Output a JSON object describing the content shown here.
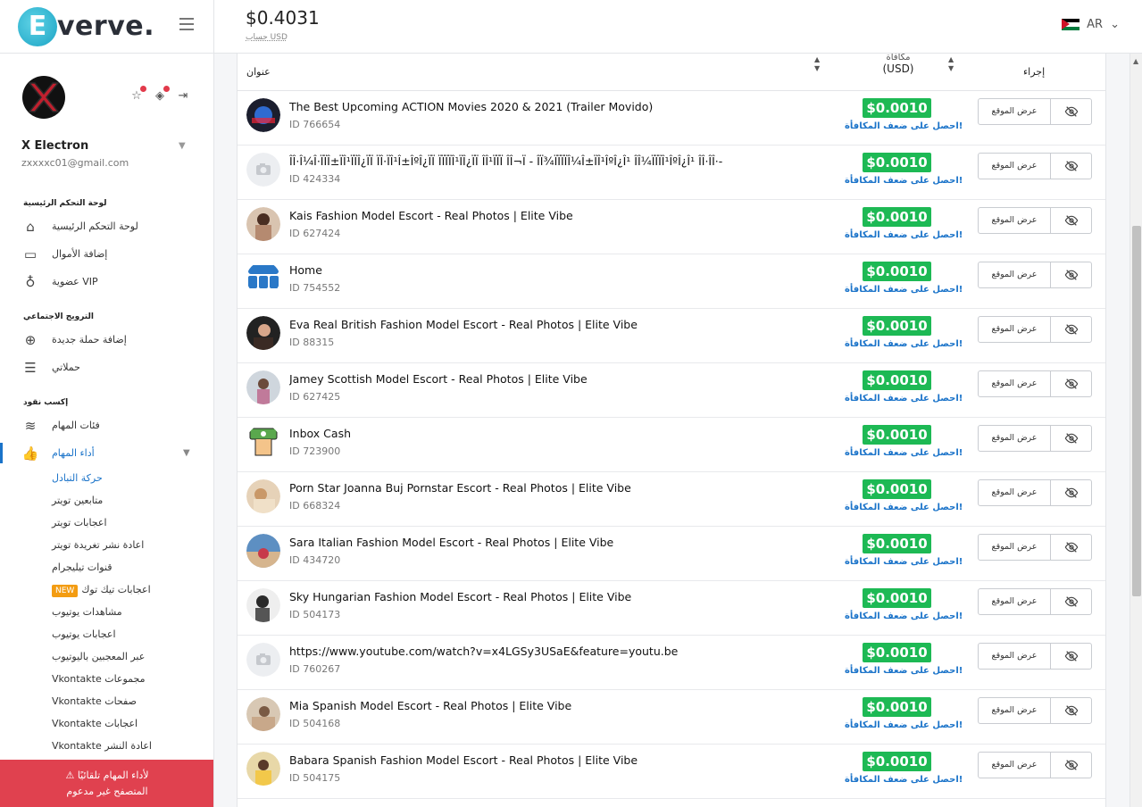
{
  "brand": {
    "logo_letter": "E",
    "logo_text": "verve."
  },
  "header": {
    "balance": "$0.4031",
    "balance_label": "حساب USD",
    "language": "AR"
  },
  "profile": {
    "name": "X Electron",
    "email": "zxxxxc01@gmail.com"
  },
  "sidebar": {
    "sections": [
      {
        "heading": "لوحة التحكم الرئيسية",
        "items": [
          {
            "label": "لوحة التحكم الرئيسية",
            "icon": "home-icon"
          },
          {
            "label": "إضافة الأموال",
            "icon": "card-icon"
          },
          {
            "label": "عضوية VIP",
            "icon": "award-icon"
          }
        ]
      },
      {
        "heading": "الترويج الاجتماعي",
        "items": [
          {
            "label": "إضافة حملة جديدة",
            "icon": "plus-circle-icon"
          },
          {
            "label": "حملاتي",
            "icon": "list-icon"
          }
        ]
      },
      {
        "heading": "إكسب نقود",
        "items": [
          {
            "label": "فئات المهام",
            "icon": "layers-icon"
          },
          {
            "label": "أداء المهام",
            "icon": "thumbs-up-icon"
          }
        ]
      }
    ],
    "sub_items": [
      "حركة التبادل",
      "متابعين تويتر",
      "اعجابات تويتر",
      "اعادة نشر تغريدة تويتر",
      "قنوات تيليجرام",
      "اعجابات تيك توك",
      "مشاهدات يوتيوب",
      "اعجابات يوتيوب",
      "عبر المعجبين باليوتيوب",
      "Vkontakte مجموعات",
      "Vkontakte صفحات",
      "Vkontakte اعجابات",
      "Vkontakte اعادة النشر"
    ],
    "new_badge": "NEW",
    "warning_line1": "لأداء المهام تلقائيًا",
    "warning_line2": "المتصفح غير مدعوم"
  },
  "table": {
    "col_title": "عنوان",
    "col_reward_top": "مكافأة",
    "col_reward": "(USD)",
    "col_action": "إجراء",
    "visit_label": "عرض الموقع",
    "double_label": "احصل على ضعف المكافأة!",
    "rows": [
      {
        "title": "The Best Upcoming ACTION Movies 2020 & 2021 (Trailer Movido)",
        "id": "ID 766654",
        "price": "$0.0010",
        "thumb": "movie"
      },
      {
        "title": "ÎÎ·Î¼Î·ÏÏÎ±ÏÎ¹ÏÏÎ¿ÏÏ ÏÎ·ÏÎ¹Î±ÎºÎ¿ÏÏ ÏÏÏÏÎ¹ÏÎ¿ÏÏ ÎÎ¹ÏÏÏ ÎÎ¬Ï - ÎÏ¾ÏÏÏÏÎ¼Î±ÏÎ¹ÎºÎ¿Î¹ ÎÎ¼ÏÏÏÎ¹ÎºÎ¿Î¹ ÎÎ·ÎÎ·-",
        "id": "ID 424334",
        "price": "$0.0010",
        "thumb": "camera"
      },
      {
        "title": "Kais Fashion Model Escort - Real Photos | Elite Vibe",
        "id": "ID 627424",
        "price": "$0.0010",
        "thumb": "photo1"
      },
      {
        "title": "Home",
        "id": "ID 754552",
        "price": "$0.0010",
        "thumb": "home"
      },
      {
        "title": "Eva Real British Fashion Model Escort - Real Photos | Elite Vibe",
        "id": "ID 88315",
        "price": "$0.0010",
        "thumb": "photo2"
      },
      {
        "title": "Jamey Scottish Model Escort - Real Photos | Elite Vibe",
        "id": "ID 627425",
        "price": "$0.0010",
        "thumb": "photo3"
      },
      {
        "title": "Inbox Cash",
        "id": "ID 723900",
        "price": "$0.0010",
        "thumb": "cash"
      },
      {
        "title": "Porn Star Joanna Buj Pornstar Escort - Real Photos | Elite Vibe",
        "id": "ID 668324",
        "price": "$0.0010",
        "thumb": "photo4"
      },
      {
        "title": "Sara Italian Fashion Model Escort - Real Photos | Elite Vibe",
        "id": "ID 434720",
        "price": "$0.0010",
        "thumb": "photo5"
      },
      {
        "title": "Sky Hungarian Fashion Model Escort - Real Photos | Elite Vibe",
        "id": "ID 504173",
        "price": "$0.0010",
        "thumb": "photo6"
      },
      {
        "title": "https://www.youtube.com/watch?v=x4LGSy3USaE&feature=youtu.be",
        "id": "ID 760267",
        "price": "$0.0010",
        "thumb": "camera"
      },
      {
        "title": "Mia Spanish Model Escort - Real Photos | Elite Vibe",
        "id": "ID 504168",
        "price": "$0.0010",
        "thumb": "photo7"
      },
      {
        "title": "Babara Spanish Fashion Model Escort - Real Photos | Elite Vibe",
        "id": "ID 504175",
        "price": "$0.0010",
        "thumb": "photo8"
      }
    ]
  },
  "colors": {
    "accent": "#1a73c9",
    "price_bg": "#1db954",
    "warning": "#e0414f"
  }
}
